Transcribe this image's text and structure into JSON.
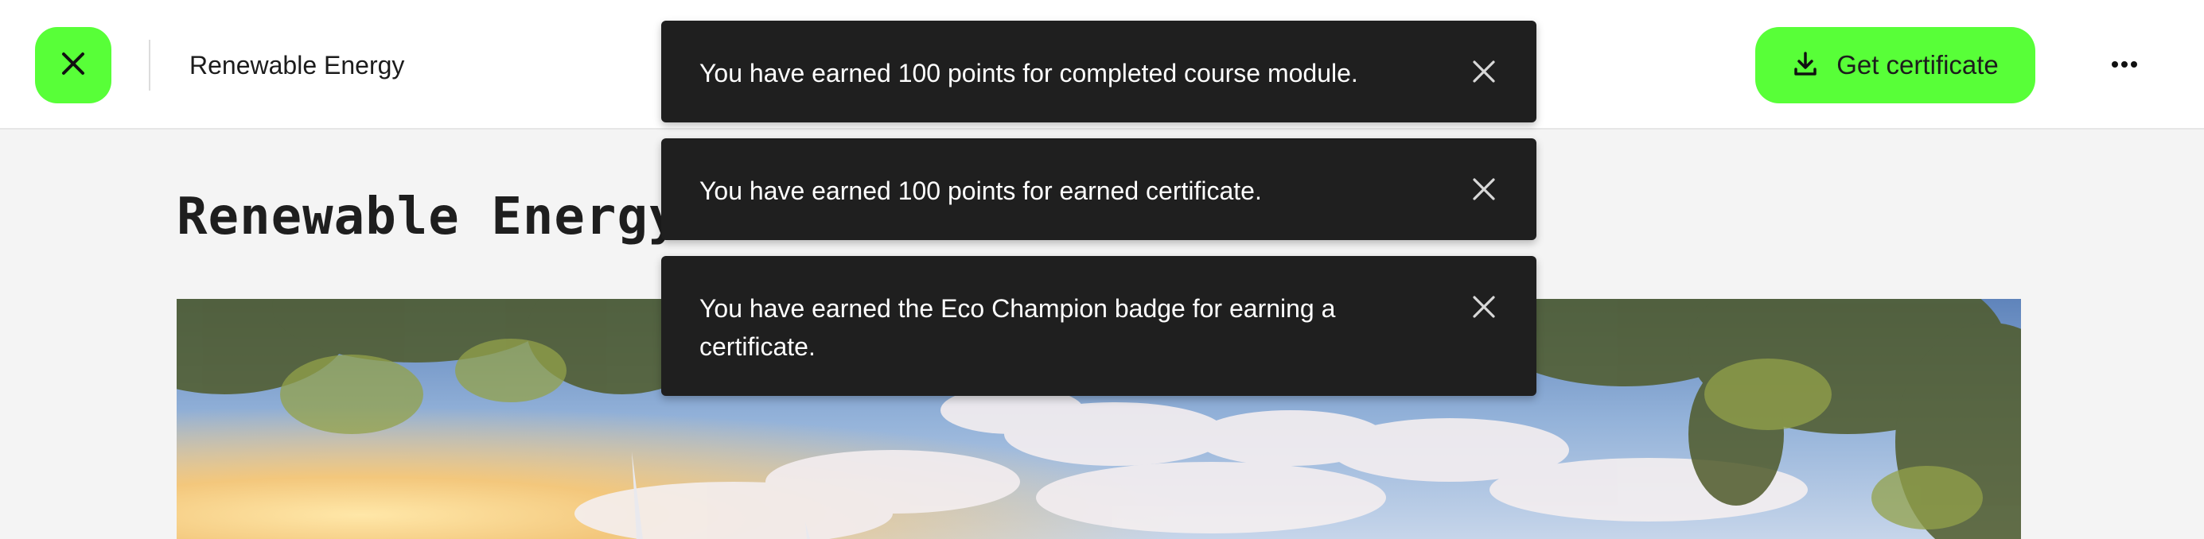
{
  "header": {
    "close_icon": "close-icon",
    "course_title": "Renewable Energy",
    "certificate_button": {
      "label": "Get certificate",
      "icon": "download-icon"
    },
    "more_icon": "more-horizontal-icon"
  },
  "main": {
    "heading": "Renewable Energy",
    "hero_image": "wind-turbines-sky-photo"
  },
  "toasts": [
    {
      "message": "You have earned 100 points for completed course module.",
      "close_icon": "close-icon"
    },
    {
      "message": "You have earned 100 points for earned certificate.",
      "close_icon": "close-icon"
    },
    {
      "message": "You have earned the Eco Champion badge for earning a certificate.",
      "close_icon": "close-icon"
    }
  ],
  "colors": {
    "accent": "#58ff38",
    "toast_background": "#1f1f1f",
    "page_background": "#f4f4f4"
  }
}
